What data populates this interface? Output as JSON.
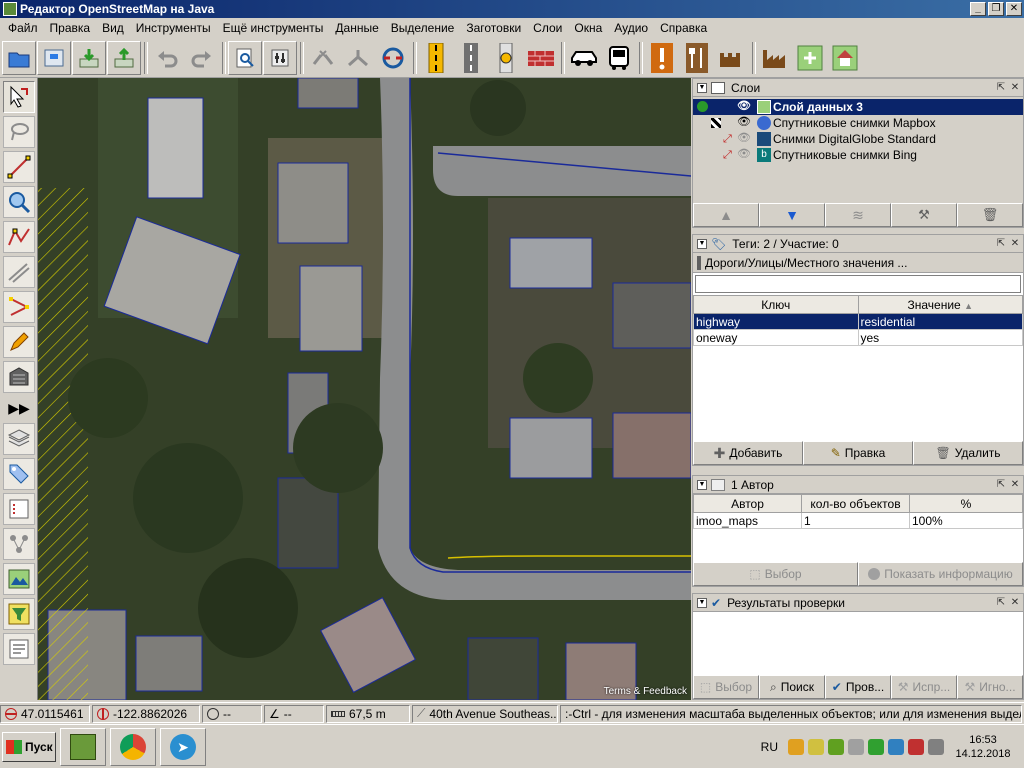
{
  "window": {
    "title": "Редактор OpenStreetMap на Java"
  },
  "menu": [
    "Файл",
    "Правка",
    "Вид",
    "Инструменты",
    "Ещё инструменты",
    "Данные",
    "Выделение",
    "Заготовки",
    "Слои",
    "Окна",
    "Аудио",
    "Справка"
  ],
  "layers_panel": {
    "title": "Слои",
    "layers": [
      {
        "name": "Слой данных 3",
        "selected": true
      },
      {
        "name": "Спутниковые снимки Mapbox",
        "selected": false
      },
      {
        "name": "Снимки DigitalGlobe Standard",
        "selected": false
      },
      {
        "name": "Спутниковые снимки Bing",
        "selected": false
      }
    ]
  },
  "tags_panel": {
    "title": "Теги: 2 / Участие: 0",
    "preset": "Дороги/Улицы/Местного значения ...",
    "col_key": "Ключ",
    "col_value": "Значение",
    "rows": [
      {
        "key": "highway",
        "value": "residential"
      },
      {
        "key": "oneway",
        "value": "yes"
      }
    ],
    "btn_add": "Добавить",
    "btn_edit": "Правка",
    "btn_delete": "Удалить"
  },
  "authors_panel": {
    "title": "1 Автор",
    "col_author": "Автор",
    "col_count": "кол-во объектов",
    "col_pct": "%",
    "rows": [
      {
        "author": "imoo_maps",
        "count": "1",
        "pct": "100%"
      }
    ],
    "btn_select": "Выбор",
    "btn_info": "Показать информацию"
  },
  "validation_panel": {
    "title": "Результаты проверки",
    "btn_select": "Выбор",
    "btn_search": "Поиск",
    "btn_check": "Пров...",
    "btn_fix": "Испр...",
    "btn_ignore": "Игно..."
  },
  "map": {
    "attribution": "Terms & Feedback"
  },
  "status": {
    "lat": "47.0115461",
    "lon": "-122.8862026",
    "heading": "--",
    "angle": "--",
    "distance": "67,5 m",
    "street": "40th Avenue Southeas...",
    "help": ":-Ctrl - для изменения масштаба выделенных объектов; или для изменения выделения"
  },
  "taskbar": {
    "start": "Пуск",
    "lang": "RU",
    "time": "16:53",
    "date": "14.12.2018"
  }
}
